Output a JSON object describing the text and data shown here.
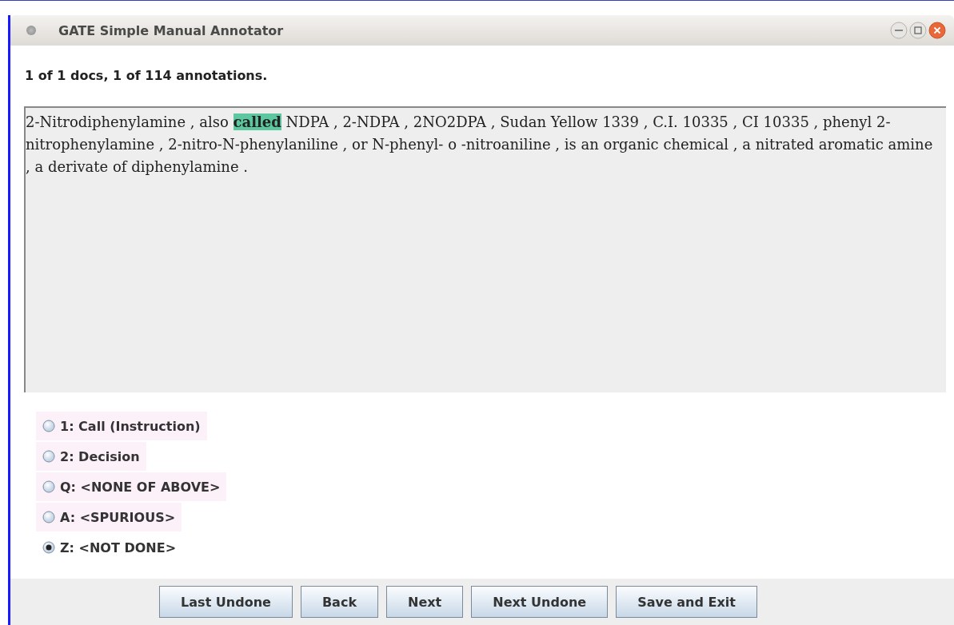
{
  "window": {
    "title": "GATE Simple Manual Annotator"
  },
  "status": "1 of 1 docs, 1 of 114 annotations.",
  "document": [
    {
      "text": "2-Nitrodiphenylamine , also ",
      "highlighted": false
    },
    {
      "text": "called",
      "highlighted": true
    },
    {
      "text": " NDPA , 2-NDPA , 2NO2DPA , Sudan Yellow 1339 , C.I. 10335 , CI 10335 , phenyl 2-nitrophenylamine , 2-nitro-N-phenylaniline , or N-phenyl- o -nitroaniline , is an organic chemical , a nitrated aromatic amine , a derivate of diphenylamine .",
      "highlighted": false
    }
  ],
  "options": [
    {
      "label": "1: Call (Instruction)",
      "selected": false
    },
    {
      "label": "2: Decision",
      "selected": false
    },
    {
      "label": "Q: <NONE OF ABOVE>",
      "selected": false
    },
    {
      "label": "A: <SPURIOUS>",
      "selected": false
    },
    {
      "label": "Z: <NOT DONE>",
      "selected": true
    }
  ],
  "buttons": [
    "Last Undone",
    "Back",
    "Next",
    "Next Undone",
    "Save and Exit"
  ]
}
